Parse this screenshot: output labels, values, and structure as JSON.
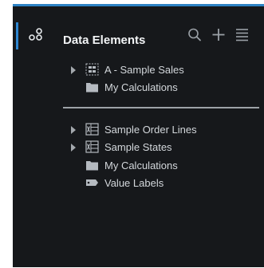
{
  "panel": {
    "title": "Data Elements",
    "accent_color": "#2e86d0",
    "toolbar": {
      "search_icon": "search-icon",
      "add_icon": "plus-icon",
      "menu_icon": "hamburger-menu-icon"
    }
  },
  "group1": {
    "items": [
      {
        "label": "A - Sample Sales",
        "icon": "subject-area-icon",
        "expandable": true
      },
      {
        "label": "My Calculations",
        "icon": "folder-icon",
        "expandable": false
      }
    ]
  },
  "group2": {
    "items": [
      {
        "label": "Sample Order Lines",
        "icon": "spreadsheet-icon",
        "expandable": true
      },
      {
        "label": "Sample States",
        "icon": "spreadsheet-icon",
        "expandable": true
      },
      {
        "label": "My Calculations",
        "icon": "folder-icon",
        "expandable": false
      },
      {
        "label": "Value Labels",
        "icon": "tag-icon",
        "expandable": false
      }
    ]
  }
}
